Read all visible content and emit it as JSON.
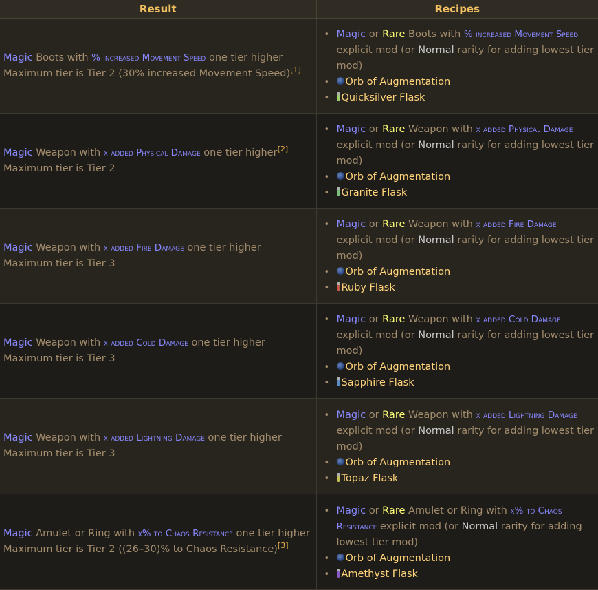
{
  "headers": {
    "result": "Result",
    "recipes": "Recipes"
  },
  "words": {
    "magic": "Magic",
    "or": "or",
    "rare": "Rare",
    "with": "with",
    "one_tier_higher": "one tier higher",
    "explicit_mod": "explicit mod (or",
    "normal": "Normal",
    "rarity_tail": "rarity for adding lowest tier mod)",
    "max_tier": "Maximum tier is"
  },
  "rows": [
    {
      "item": "Boots",
      "stat": "% increased Movement Speed",
      "result_suffix": "one tier higher",
      "max": "Maximum tier is Tier 2 (30% increased Movement Speed)",
      "ref": "[1]",
      "orb": "Orb of Augmentation",
      "flask": "Quicksilver Flask",
      "flask_color": "#9fd070"
    },
    {
      "item": "Weapon",
      "stat": "x added Physical Damage",
      "result_suffix": "one tier higher",
      "max": "Maximum tier is Tier 2",
      "ref": "[2]",
      "orb": "Orb of Augmentation",
      "flask": "Granite Flask",
      "flask_color": "#7cbc7c"
    },
    {
      "item": "Weapon",
      "stat": "x added Fire Damage",
      "result_suffix": "one tier higher",
      "max": "Maximum tier is Tier 3",
      "ref": "",
      "orb": "Orb of Augmentation",
      "flask": "Ruby Flask",
      "flask_color": "#c65a4a"
    },
    {
      "item": "Weapon",
      "stat": "x added Cold Damage",
      "result_suffix": "one tier higher",
      "max": "Maximum tier is Tier 3",
      "ref": "",
      "orb": "Orb of Augmentation",
      "flask": "Sapphire Flask",
      "flask_color": "#5a8cc6"
    },
    {
      "item": "Weapon",
      "stat": "x added Lightning Damage",
      "result_suffix": "one tier higher",
      "max": "Maximum tier is Tier 3",
      "ref": "",
      "orb": "Orb of Augmentation",
      "flask": "Topaz Flask",
      "flask_color": "#c6c05a"
    },
    {
      "item": "Amulet or Ring",
      "stat": "x% to Chaos Resistance",
      "result_suffix": "one tier higher",
      "max": "Maximum tier is Tier 2 ((26–30)% to Chaos Resistance)",
      "ref": "[3]",
      "orb": "Orb of Augmentation",
      "flask": "Amethyst Flask",
      "flask_color": "#8c5ac6"
    }
  ]
}
